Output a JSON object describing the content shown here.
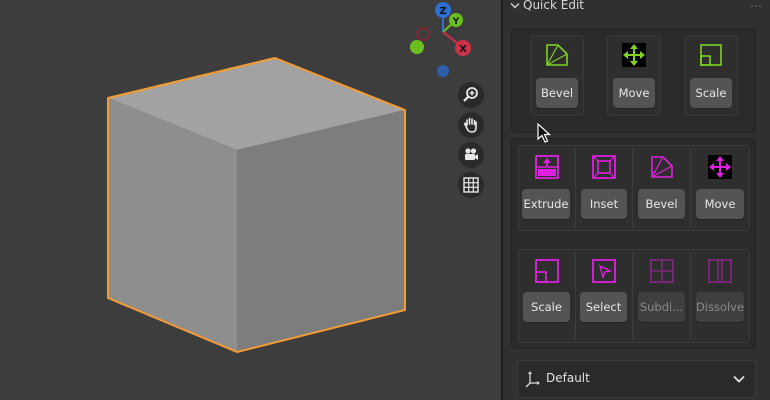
{
  "panel": {
    "title": "Quick Edit"
  },
  "gizmo": {
    "z": "Z",
    "y": "Y",
    "x": "X"
  },
  "object_tools": [
    {
      "label": "Bevel",
      "icon": "bevel-icon"
    },
    {
      "label": "Move",
      "icon": "move-icon"
    },
    {
      "label": "Scale",
      "icon": "scale-icon"
    }
  ],
  "edit_tools_row1": [
    {
      "label": "Extrude",
      "icon": "extrude-icon"
    },
    {
      "label": "Inset",
      "icon": "inset-icon"
    },
    {
      "label": "Bevel",
      "icon": "bevel-icon"
    },
    {
      "label": "Move",
      "icon": "move-icon"
    }
  ],
  "edit_tools_row2": [
    {
      "label": "Scale",
      "icon": "scale-icon",
      "enabled": true
    },
    {
      "label": "Select",
      "icon": "select-icon",
      "enabled": true
    },
    {
      "label": "Subdi...",
      "icon": "subdivide-icon",
      "enabled": false
    },
    {
      "label": "Dissolve",
      "icon": "dissolve-icon",
      "enabled": false
    }
  ],
  "orientation": {
    "label": "Default"
  },
  "colors": {
    "object_accent": "#7fd320",
    "edit_accent": "#e020e0",
    "selection_outline": "#f39c32"
  }
}
